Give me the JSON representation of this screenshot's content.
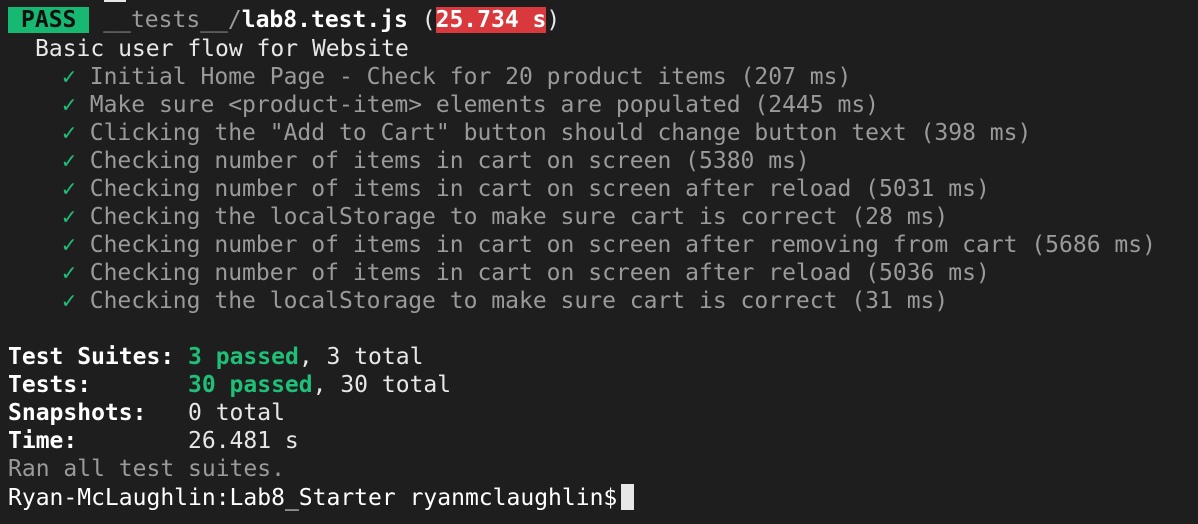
{
  "header": {
    "status": "PASS",
    "path_dir": "__tests__/",
    "path_file": "lab8.test.js",
    "open_paren": " (",
    "duration": "25.734 s",
    "close_paren": ")"
  },
  "suite": {
    "title": "Basic user flow for Website",
    "check_glyph": "✓",
    "tests": [
      "Initial Home Page - Check for 20 product items (207 ms)",
      "Make sure <product-item> elements are populated (2445 ms)",
      "Clicking the \"Add to Cart\" button should change button text (398 ms)",
      "Checking number of items in cart on screen (5380 ms)",
      "Checking number of items in cart on screen after reload (5031 ms)",
      "Checking the localStorage to make sure cart is correct (28 ms)",
      "Checking number of items in cart on screen after removing from cart (5686 ms)",
      "Checking number of items in cart on screen after reload (5036 ms)",
      "Checking the localStorage to make sure cart is correct (31 ms)"
    ]
  },
  "summary": {
    "suites_label": "Test Suites:",
    "suites_passed": "3 passed",
    "suites_total": ", 3 total",
    "tests_label": "Tests:",
    "tests_passed": "30 passed",
    "tests_total": ", 30 total",
    "snapshots_label": "Snapshots:",
    "snapshots_value": "0 total",
    "time_label": "Time:",
    "time_value": "26.481 s",
    "ran_all": "Ran all test suites."
  },
  "prompt": {
    "text": "Ryan-McLaughlin:Lab8_Starter ryanmclaughlin$"
  },
  "colors": {
    "background": "#1e1e1e",
    "pass_green": "#17b872",
    "check_green": "#1fbf77",
    "time_red": "#d9383c",
    "dim_gray": "#9a9a9a"
  }
}
